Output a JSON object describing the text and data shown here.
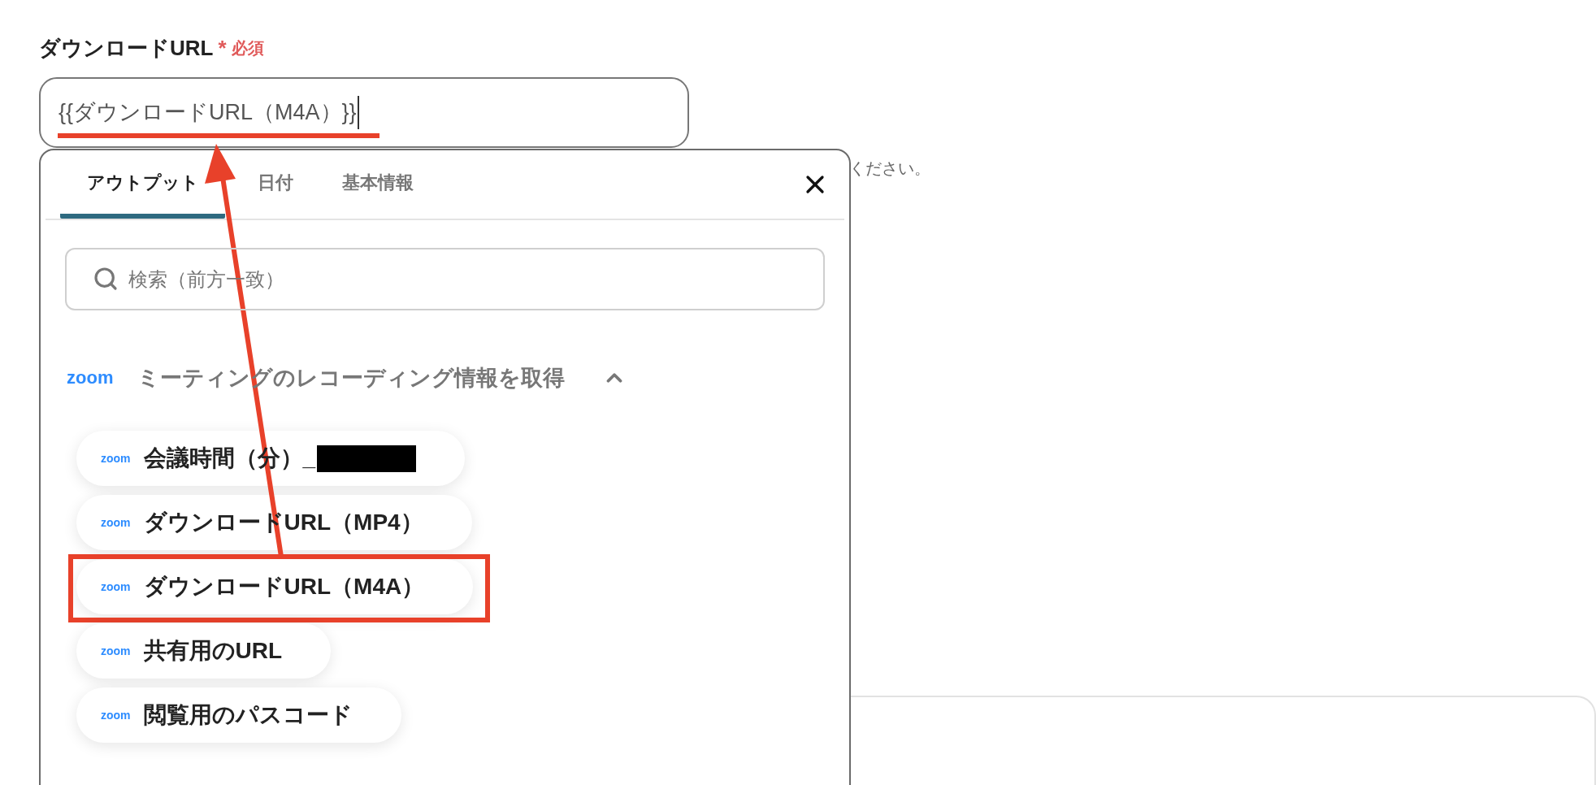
{
  "field": {
    "label": "ダウンロードURL",
    "required_mark": "*",
    "required_text": "必須",
    "value": "{{ダウンロードURL（M4A）}}",
    "underlined": true,
    "hint": "ください。"
  },
  "picker": {
    "tabs": [
      {
        "label": "アウトプット",
        "selected": true
      },
      {
        "label": "日付",
        "selected": false
      },
      {
        "label": "基本情報",
        "selected": false
      }
    ],
    "search": {
      "placeholder": "検索（前方一致）"
    },
    "group": {
      "logo": "zoom",
      "title": "ミーティングのレコーディング情報を取得",
      "expanded": true,
      "items": [
        {
          "logo": "zoom",
          "label": "会議時間（分）_",
          "redacted": true,
          "marked": false
        },
        {
          "logo": "zoom",
          "label": "ダウンロードURL（MP4）",
          "redacted": false,
          "marked": false
        },
        {
          "logo": "zoom",
          "label": "ダウンロードURL（M4A）",
          "redacted": false,
          "marked": true
        },
        {
          "logo": "zoom",
          "label": "共有用のURL",
          "redacted": false,
          "marked": false
        },
        {
          "logo": "zoom",
          "label": "閲覧用のパスコード",
          "redacted": false,
          "marked": false
        }
      ]
    }
  }
}
